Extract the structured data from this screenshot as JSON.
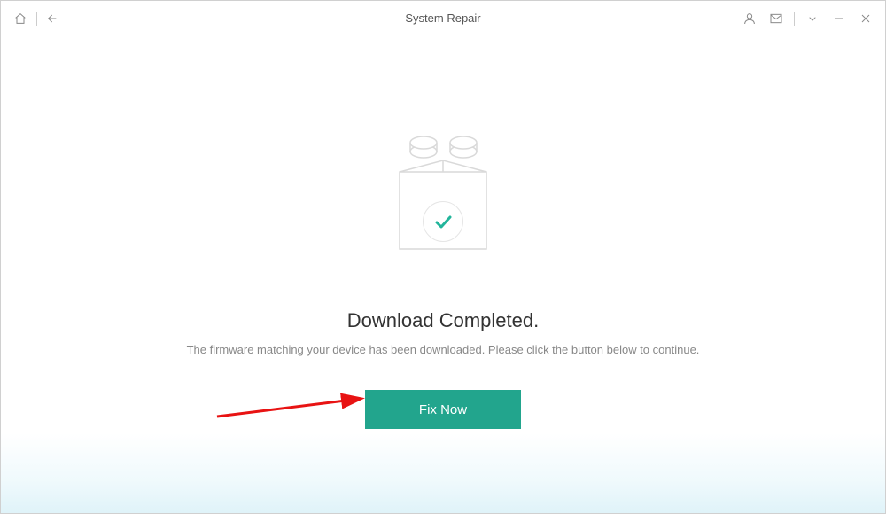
{
  "window": {
    "title": "System Repair"
  },
  "content": {
    "headline": "Download Completed.",
    "subtext": "The firmware matching your device has been downloaded. Please click the button below to continue.",
    "fix_button_label": "Fix Now"
  },
  "colors": {
    "accent": "#22a58d",
    "checkmark": "#22b59b"
  }
}
